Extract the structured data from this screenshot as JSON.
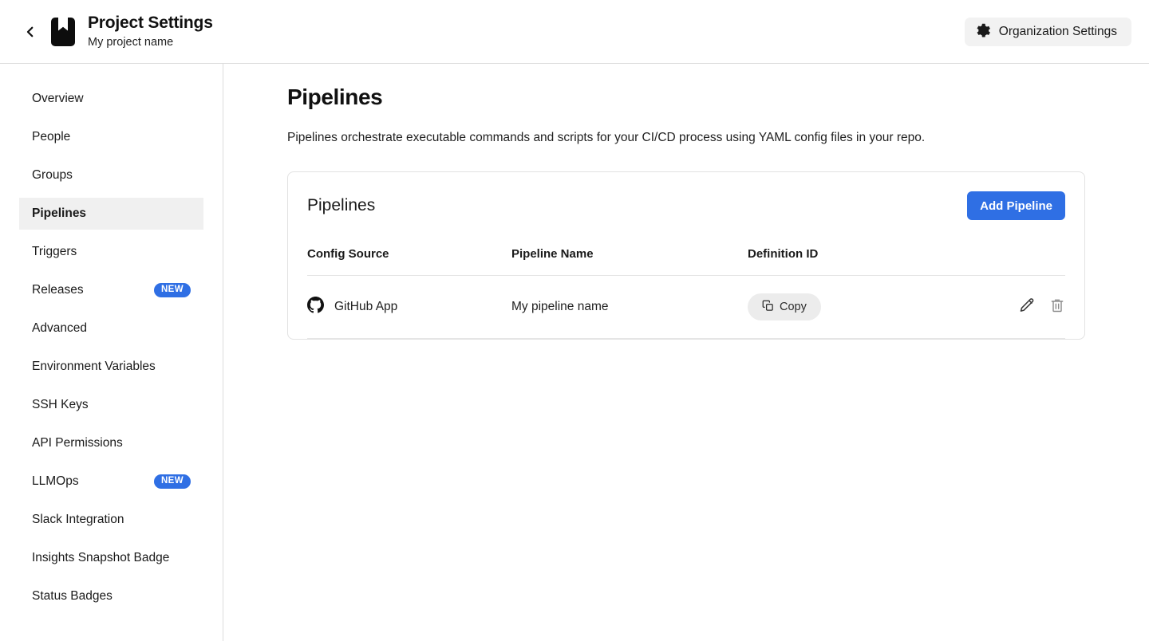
{
  "header": {
    "back_icon": "chevron-left-icon",
    "app_icon": "book-bookmark-icon",
    "title": "Project Settings",
    "subtitle": "My project name",
    "org_button": {
      "label": "Organization Settings",
      "icon": "gear-icon"
    }
  },
  "sidebar": {
    "items": [
      {
        "label": "Overview",
        "active": false,
        "badge": null
      },
      {
        "label": "People",
        "active": false,
        "badge": null
      },
      {
        "label": "Groups",
        "active": false,
        "badge": null
      },
      {
        "label": "Pipelines",
        "active": true,
        "badge": null
      },
      {
        "label": "Triggers",
        "active": false,
        "badge": null
      },
      {
        "label": "Releases",
        "active": false,
        "badge": "NEW"
      },
      {
        "label": "Advanced",
        "active": false,
        "badge": null
      },
      {
        "label": "Environment Variables",
        "active": false,
        "badge": null
      },
      {
        "label": "SSH Keys",
        "active": false,
        "badge": null
      },
      {
        "label": "API Permissions",
        "active": false,
        "badge": null
      },
      {
        "label": "LLMOps",
        "active": false,
        "badge": "NEW"
      },
      {
        "label": "Slack Integration",
        "active": false,
        "badge": null
      },
      {
        "label": "Insights Snapshot Badge",
        "active": false,
        "badge": null
      },
      {
        "label": "Status Badges",
        "active": false,
        "badge": null
      }
    ]
  },
  "main": {
    "page_title": "Pipelines",
    "page_description": "Pipelines orchestrate executable commands and scripts for your CI/CD process using YAML config files in your repo.",
    "card": {
      "title": "Pipelines",
      "add_button": "Add Pipeline",
      "table": {
        "columns": [
          "Config Source",
          "Pipeline Name",
          "Definition ID",
          ""
        ],
        "rows": [
          {
            "config_source": "GitHub App",
            "config_source_icon": "github-icon",
            "pipeline_name": "My pipeline name",
            "definition_id_button": "Copy",
            "definition_id_icon": "copy-icon",
            "actions": [
              "pencil-icon",
              "trash-icon"
            ]
          }
        ]
      }
    }
  },
  "colors": {
    "accent_blue": "#2f6fe4",
    "badge_blue": "#2f6fe4",
    "active_nav_bg": "#f0f0f0",
    "pill_gray": "#ececec",
    "border_gray": "#e2e2e2"
  }
}
